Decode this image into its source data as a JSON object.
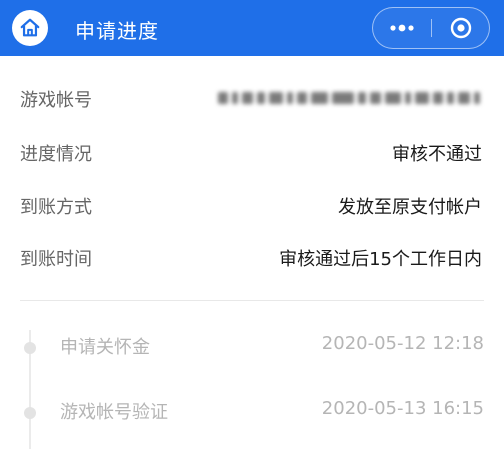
{
  "header": {
    "title": "申请进度",
    "home_icon": "home-icon",
    "more_icon": "more-dots-icon",
    "close_icon": "close-circle-icon",
    "bar_color": "#1f6fe8"
  },
  "details": [
    {
      "label": "游戏帐号",
      "value": ""
    },
    {
      "label": "进度情况",
      "value": "审核不通过"
    },
    {
      "label": "到账方式",
      "value": "发放至原支付帐户"
    },
    {
      "label": "到账时间",
      "value": "审核通过后15个工作日内"
    }
  ],
  "timeline": [
    {
      "label": "申请关怀金",
      "time": "2020-05-12 12:18"
    },
    {
      "label": "游戏帐号验证",
      "time": "2020-05-13 16:15"
    }
  ]
}
